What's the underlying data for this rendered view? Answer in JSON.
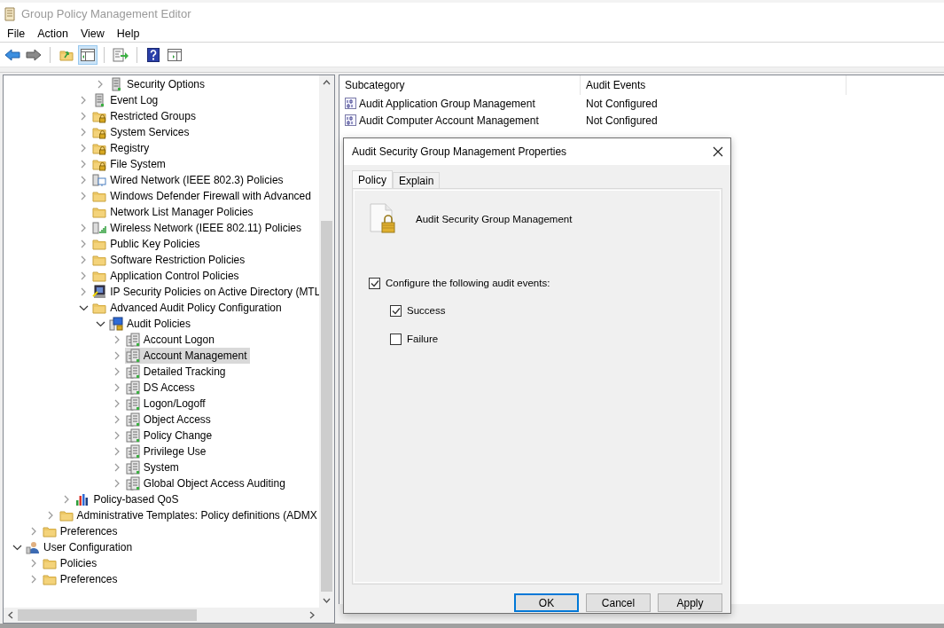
{
  "window": {
    "title": "Group Policy Management Editor"
  },
  "menu": [
    "File",
    "Action",
    "View",
    "Help"
  ],
  "toolbar": [
    {
      "kind": "back",
      "pressed": false
    },
    {
      "kind": "forward",
      "pressed": false
    },
    {
      "kind": "separator"
    },
    {
      "kind": "up-folder",
      "pressed": false
    },
    {
      "kind": "tree-pane",
      "pressed": true
    },
    {
      "kind": "separator"
    },
    {
      "kind": "export",
      "pressed": false
    },
    {
      "kind": "separator"
    },
    {
      "kind": "help",
      "pressed": false
    },
    {
      "kind": "action-pane",
      "pressed": false
    }
  ],
  "tree": [
    {
      "children": [
        {
          "children": [
            {
              "children": [
                {
                  "children": [
                    {
                      "children": [
                        {
                          "label": "Security Options",
                          "kind": "server",
                          "expandable": true,
                          "expanded": false,
                          "selected": false
                        }
                      ]
                    },
                    {
                      "label": "Event Log",
                      "kind": "server",
                      "expandable": true,
                      "expanded": false,
                      "selected": false
                    },
                    {
                      "label": "Restricted Groups",
                      "kind": "lock-folder",
                      "expandable": true,
                      "expanded": false,
                      "selected": false
                    },
                    {
                      "label": "System Services",
                      "kind": "lock-folder",
                      "expandable": true,
                      "expanded": false,
                      "selected": false
                    },
                    {
                      "label": "Registry",
                      "kind": "lock-folder",
                      "expandable": true,
                      "expanded": false,
                      "selected": false
                    },
                    {
                      "label": "File System",
                      "kind": "lock-folder",
                      "expandable": true,
                      "expanded": false,
                      "selected": false
                    },
                    {
                      "label": "Wired Network (IEEE 802.3) Policies",
                      "kind": "network",
                      "expandable": true,
                      "expanded": false,
                      "selected": false
                    },
                    {
                      "label": "Windows Defender Firewall with Advanced",
                      "kind": "folder",
                      "expandable": true,
                      "expanded": false,
                      "selected": false
                    },
                    {
                      "label": "Network List Manager Policies",
                      "kind": "folder",
                      "expandable": false,
                      "selected": false
                    },
                    {
                      "label": "Wireless Network (IEEE 802.11) Policies",
                      "kind": "wireless",
                      "expandable": true,
                      "expanded": false,
                      "selected": false
                    },
                    {
                      "label": "Public Key Policies",
                      "kind": "folder",
                      "expandable": true,
                      "expanded": false,
                      "selected": false
                    },
                    {
                      "label": "Software Restriction Policies",
                      "kind": "folder",
                      "expandable": true,
                      "expanded": false,
                      "selected": false
                    },
                    {
                      "label": "Application Control Policies",
                      "kind": "folder",
                      "expandable": true,
                      "expanded": false,
                      "selected": false
                    },
                    {
                      "label": "IP Security Policies on Active Directory (MTL",
                      "kind": "ip-security",
                      "expandable": true,
                      "expanded": false,
                      "selected": false
                    },
                    {
                      "label": "Advanced Audit Policy Configuration",
                      "kind": "folder",
                      "expandable": true,
                      "expanded": true,
                      "selected": false,
                      "children": [
                        {
                          "label": "Audit Policies",
                          "kind": "audit",
                          "expandable": true,
                          "expanded": true,
                          "selected": false,
                          "children": [
                            {
                              "label": "Account Logon",
                              "kind": "policy",
                              "expandable": true,
                              "expanded": false,
                              "selected": false
                            },
                            {
                              "label": "Account Management",
                              "kind": "policy",
                              "expandable": true,
                              "expanded": false,
                              "selected": true
                            },
                            {
                              "label": "Detailed Tracking",
                              "kind": "policy",
                              "expandable": true,
                              "expanded": false,
                              "selected": false
                            },
                            {
                              "label": "DS Access",
                              "kind": "policy",
                              "expandable": true,
                              "expanded": false,
                              "selected": false
                            },
                            {
                              "label": "Logon/Logoff",
                              "kind": "policy",
                              "expandable": true,
                              "expanded": false,
                              "selected": false
                            },
                            {
                              "label": "Object Access",
                              "kind": "policy",
                              "expandable": true,
                              "expanded": false,
                              "selected": false
                            },
                            {
                              "label": "Policy Change",
                              "kind": "policy",
                              "expandable": true,
                              "expanded": false,
                              "selected": false
                            },
                            {
                              "label": "Privilege Use",
                              "kind": "policy",
                              "expandable": true,
                              "expanded": false,
                              "selected": false
                            },
                            {
                              "label": "System",
                              "kind": "policy",
                              "expandable": true,
                              "expanded": false,
                              "selected": false
                            },
                            {
                              "label": "Global Object Access Auditing",
                              "kind": "policy",
                              "expandable": true,
                              "expanded": false,
                              "selected": false
                            }
                          ]
                        }
                      ]
                    }
                  ]
                },
                {
                  "label": "Policy-based QoS",
                  "kind": "chart",
                  "expandable": true,
                  "expanded": false,
                  "selected": false
                }
              ]
            },
            {
              "label": "Administrative Templates: Policy definitions (ADMX",
              "kind": "folder",
              "expandable": true,
              "expanded": false,
              "selected": false
            }
          ]
        },
        {
          "label": "Preferences",
          "kind": "folder",
          "expandable": true,
          "expanded": false,
          "selected": false
        }
      ]
    },
    {
      "label": "User Configuration",
      "kind": "user",
      "expandable": true,
      "expanded": true,
      "selected": false,
      "children": [
        {
          "label": "Policies",
          "kind": "folder",
          "expandable": true,
          "expanded": false,
          "selected": false
        },
        {
          "label": "Preferences",
          "kind": "folder",
          "expandable": true,
          "expanded": false,
          "selected": false
        }
      ]
    }
  ],
  "list": {
    "columns": [
      "Subcategory",
      "Audit Events"
    ],
    "rows": [
      {
        "subcategory": "Audit Application Group Management",
        "audit_events": "Not Configured"
      },
      {
        "subcategory": "Audit Computer Account Management",
        "audit_events": "Not Configured"
      }
    ]
  },
  "dialog": {
    "title": "Audit Security Group Management Properties",
    "tabs": [
      {
        "label": "Policy",
        "selected": true
      },
      {
        "label": "Explain",
        "selected": false
      }
    ],
    "policy_name": "Audit Security Group Management",
    "configure": {
      "label": "Configure the following audit events:",
      "checked": true
    },
    "events": [
      {
        "label": "Success",
        "checked": true
      },
      {
        "label": "Failure",
        "checked": false
      }
    ],
    "buttons": [
      {
        "label": "OK",
        "default": true
      },
      {
        "label": "Cancel",
        "default": false
      },
      {
        "label": "Apply",
        "default": false
      }
    ]
  }
}
